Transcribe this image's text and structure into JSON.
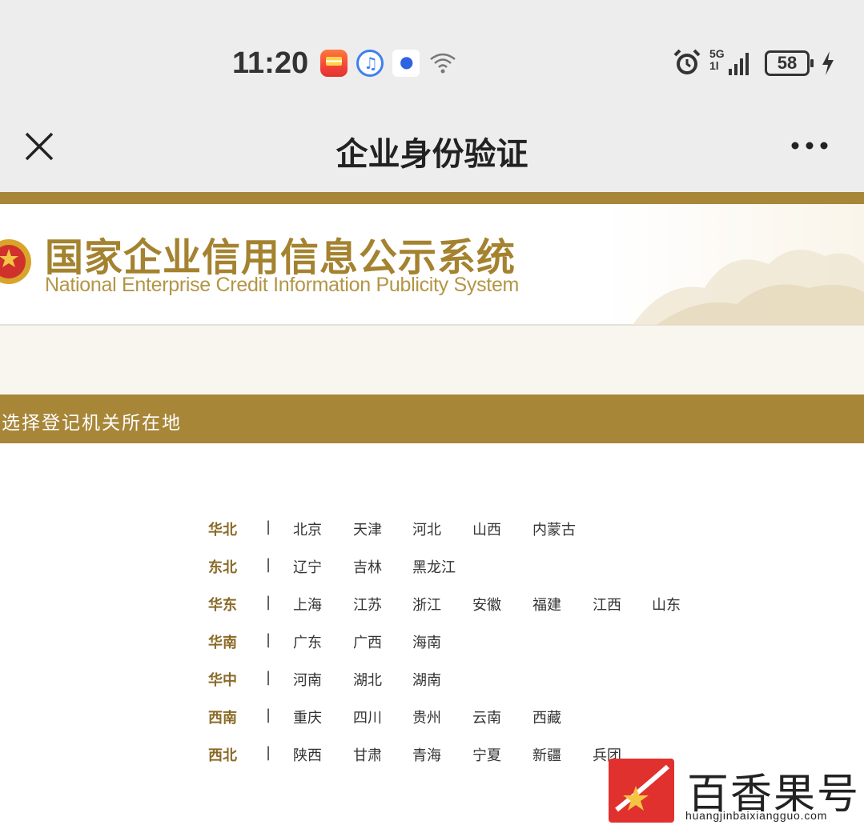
{
  "status_bar": {
    "time": "11:20",
    "network": "5G",
    "network_sub": "1l",
    "battery": "58",
    "icons": [
      "huawei-video-icon",
      "music-icon",
      "baidu-icon",
      "wifi-icon",
      "alarm-icon",
      "signal-icon",
      "battery-icon",
      "charging-icon"
    ]
  },
  "nav": {
    "title": "企业身份验证",
    "close_icon": "close-icon",
    "more_icon": "more-icon"
  },
  "banner": {
    "title": "国家企业信用信息公示系统",
    "subtitle": "National Enterprise Credit Information Publicity System"
  },
  "section": {
    "label": "选择登记机关所在地"
  },
  "separator": "|",
  "regions": [
    {
      "name": "华北",
      "provinces": [
        "北京",
        "天津",
        "河北",
        "山西",
        "内蒙古"
      ]
    },
    {
      "name": "东北",
      "provinces": [
        "辽宁",
        "吉林",
        "黑龙江"
      ]
    },
    {
      "name": "华东",
      "provinces": [
        "上海",
        "江苏",
        "浙江",
        "安徽",
        "福建",
        "江西",
        "山东"
      ]
    },
    {
      "name": "华南",
      "provinces": [
        "广东",
        "广西",
        "海南"
      ]
    },
    {
      "name": "华中",
      "provinces": [
        "河南",
        "湖北",
        "湖南"
      ]
    },
    {
      "name": "西南",
      "provinces": [
        "重庆",
        "四川",
        "贵州",
        "云南",
        "西藏"
      ]
    },
    {
      "name": "西北",
      "provinces": [
        "陕西",
        "甘肃",
        "青海",
        "宁夏",
        "新疆",
        "兵团"
      ]
    }
  ],
  "watermark": {
    "text": "百香果号",
    "url": "huangjinbaixiangguo.com"
  },
  "colors": {
    "gold": "#a88638",
    "region_text": "#8a6a28",
    "title_gold": "#a4822f"
  }
}
